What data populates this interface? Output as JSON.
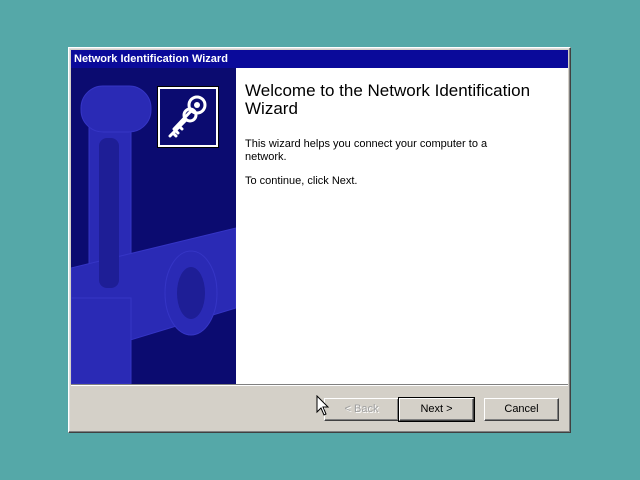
{
  "window": {
    "title": "Network Identification Wizard"
  },
  "welcome": {
    "heading": "Welcome to the Network Identification Wizard",
    "description": "This wizard helps you connect your computer to a network.",
    "continue_text": "To continue, click Next."
  },
  "buttons": {
    "back_label": "< Back",
    "back_enabled": false,
    "next_label": "Next >",
    "cancel_label": "Cancel"
  },
  "icons": {
    "wizard_icon": "keys-icon",
    "pointer": "mouse-pointer-icon"
  },
  "colors": {
    "desktop": "#55a8a8",
    "title_bar": "#0a0a9a",
    "side_panel": "#0b0b70",
    "side_art": "#2a2ab5",
    "dialog_face": "#d4d0c8"
  }
}
